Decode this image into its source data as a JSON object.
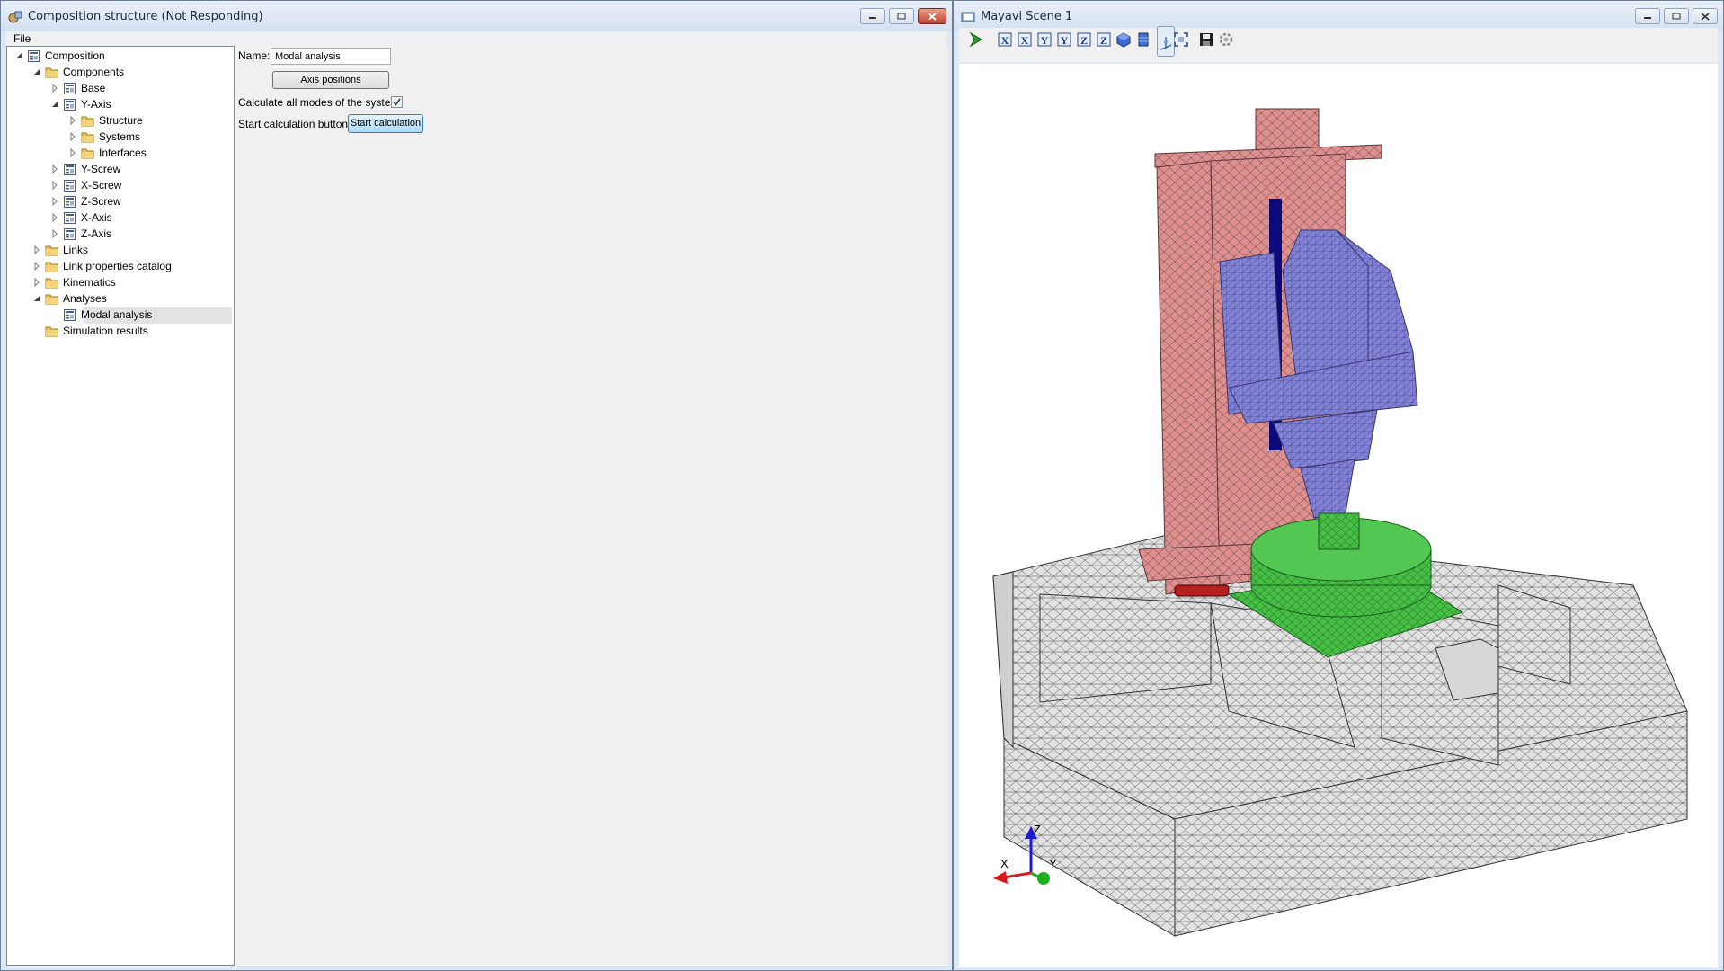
{
  "composition_window": {
    "title": "Composition structure (Not Responding)",
    "menu": {
      "file": "File"
    },
    "tree": [
      {
        "label": "Composition",
        "icon": "tree-object-icon",
        "expanded": true
      },
      {
        "label": "Components",
        "icon": "folder-icon",
        "expanded": true
      },
      {
        "label": "Base",
        "icon": "tree-object-icon",
        "expanded": false
      },
      {
        "label": "Y-Axis",
        "icon": "tree-object-icon",
        "expanded": true
      },
      {
        "label": "Structure",
        "icon": "folder-icon",
        "expanded": false
      },
      {
        "label": "Systems",
        "icon": "folder-icon",
        "expanded": false
      },
      {
        "label": "Interfaces",
        "icon": "folder-icon",
        "expanded": false
      },
      {
        "label": "Y-Screw",
        "icon": "tree-object-icon",
        "expanded": false
      },
      {
        "label": "X-Screw",
        "icon": "tree-object-icon",
        "expanded": false
      },
      {
        "label": "Z-Screw",
        "icon": "tree-object-icon",
        "expanded": false
      },
      {
        "label": "X-Axis",
        "icon": "tree-object-icon",
        "expanded": false
      },
      {
        "label": "Z-Axis",
        "icon": "tree-object-icon",
        "expanded": false
      },
      {
        "label": "Links",
        "icon": "folder-icon",
        "expanded": false
      },
      {
        "label": "Link properties catalog",
        "icon": "folder-icon",
        "expanded": false
      },
      {
        "label": "Kinematics",
        "icon": "folder-icon",
        "expanded": false
      },
      {
        "label": "Analyses",
        "icon": "folder-icon",
        "expanded": true
      },
      {
        "label": "Modal analysis",
        "icon": "tree-object-icon",
        "selected": true
      },
      {
        "label": "Simulation results",
        "icon": "folder-icon"
      }
    ],
    "form": {
      "name_label": "Name:",
      "name_value": "Modal analysis",
      "axis_positions_button": "Axis positions",
      "calc_all_modes_label": "Calculate all modes of the system:",
      "calc_all_modes_checked": true,
      "start_calc_label": "Start calculation button:",
      "start_calc_button": "Start calculation"
    }
  },
  "mayavi_window": {
    "title": "Mayavi Scene 1",
    "toolbar": [
      "pipeline-icon",
      "view-x-plus-icon",
      "view-x-minus-icon",
      "view-y-plus-icon",
      "view-y-minus-icon",
      "view-z-plus-icon",
      "view-z-minus-icon",
      "isometric-view-icon",
      "parallel-projection-icon",
      "axes-toggle-icon",
      "full-screen-icon",
      "save-icon",
      "configure-icon"
    ],
    "axes": {
      "x": "X",
      "y": "Y",
      "z": "Z"
    },
    "colors": {
      "column": "#d98a8a",
      "spindle": "#7f7fd6",
      "table": "#3fbf3f",
      "bed": "#dcdcdc",
      "mesh": "#3a3a3a"
    }
  }
}
